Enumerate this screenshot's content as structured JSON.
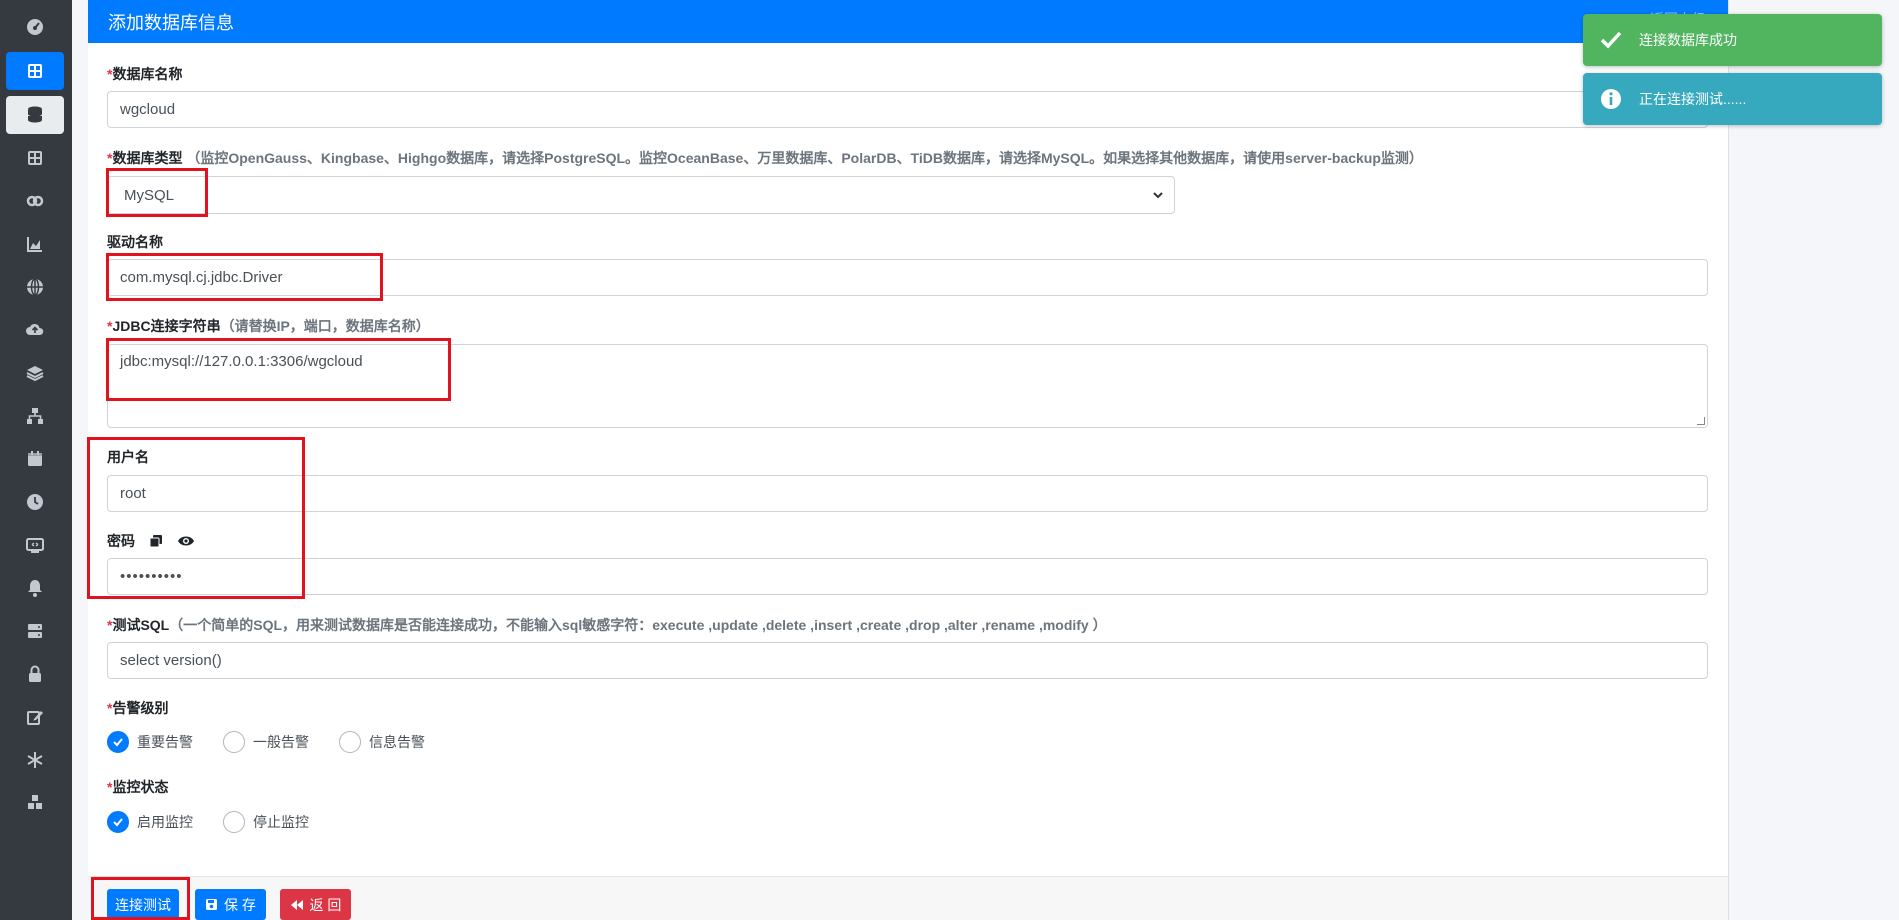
{
  "header": {
    "title": "添加数据库信息",
    "back_link": "返回上级"
  },
  "form": {
    "db_name": {
      "label": "数据库名称",
      "value": "wgcloud"
    },
    "db_type": {
      "label": "数据库类型",
      "hint": "（监控OpenGauss、Kingbase、Highgo数据库，请选择PostgreSQL。监控OceanBase、万里数据库、PolarDB、TiDB数据库，请选择MySQL。如果选择其他数据库，请使用server-backup监测）",
      "value": "MySQL"
    },
    "driver": {
      "label": "驱动名称",
      "value": "com.mysql.cj.jdbc.Driver"
    },
    "jdbc": {
      "label": "JDBC连接字符串",
      "hint": "（请替换IP，端口，数据库名称）",
      "value": "jdbc:mysql://127.0.0.1:3306/wgcloud"
    },
    "username": {
      "label": "用户名",
      "value": "root"
    },
    "password": {
      "label": "密码",
      "value": "••••••••••"
    },
    "test_sql": {
      "label": "测试SQL",
      "hint": "（一个简单的SQL，用来测试数据库是否能连接成功，不能输入sql敏感字符：execute ,update ,delete ,insert ,create ,drop ,alter ,rename ,modify ）",
      "value": "select version()"
    },
    "alarm_level": {
      "label": "告警级别",
      "options": [
        "重要告警",
        "一般告警",
        "信息告警"
      ],
      "selected": "重要告警"
    },
    "monitor_state": {
      "label": "监控状态",
      "options": [
        "启用监控",
        "停止监控"
      ],
      "selected": "启用监控"
    }
  },
  "buttons": {
    "test": "连接测试",
    "save": "保 存",
    "back": "返 回"
  },
  "toasts": {
    "success": "连接数据库成功",
    "info": "正在连接测试......"
  },
  "colors": {
    "primary": "#007bff",
    "danger": "#dc3545",
    "success": "#51b560",
    "info": "#36a9be",
    "sidebar": "#343a40",
    "highlight": "#e0131f"
  },
  "sidebar": {
    "icons": [
      "dashboard-icon",
      "grid-icon",
      "database-icon",
      "grid-icon",
      "link-icon",
      "chart-area-icon",
      "globe-icon",
      "cloud-upload-icon",
      "layers-icon",
      "network-icon",
      "calendar-icon",
      "clock-icon",
      "monitor-icon",
      "bell-icon",
      "server-icon",
      "lock-icon",
      "edit-icon",
      "snowflake-icon",
      "cubes-icon"
    ]
  }
}
